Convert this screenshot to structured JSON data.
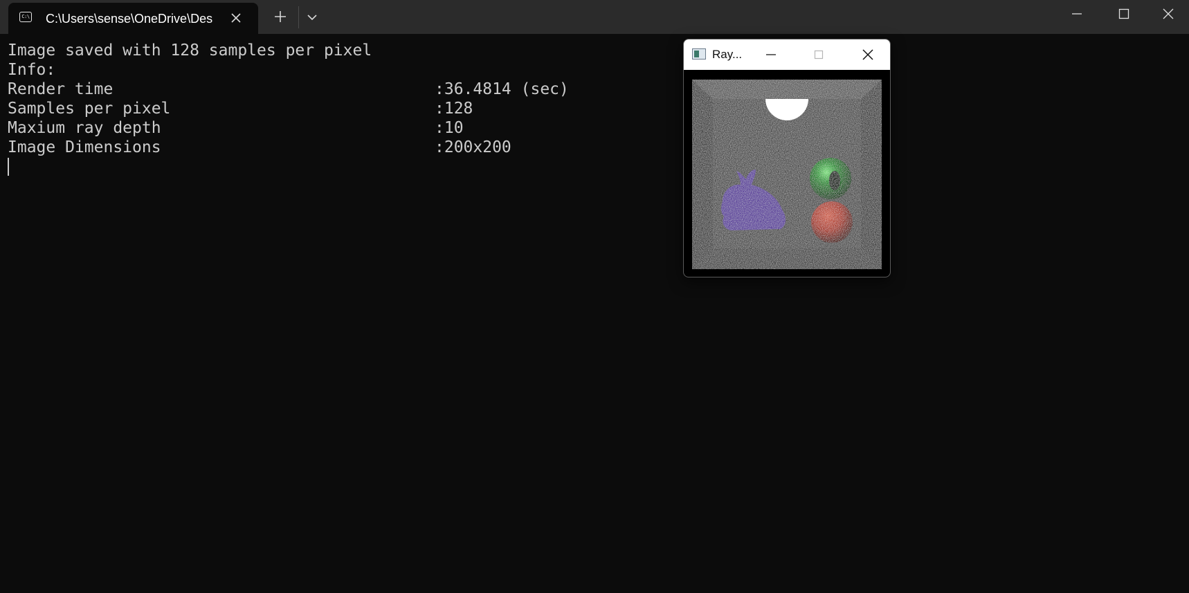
{
  "terminal": {
    "tab_title": "C:\\Users\\sense\\OneDrive\\Des",
    "tab_icon_text": "C:\\",
    "icons": {
      "tab_icon": "terminal-icon",
      "close": "close-icon",
      "new_tab": "plus-icon",
      "dropdown": "chevron-down-icon",
      "minimize": "minimize-icon",
      "maximize": "maximize-icon"
    }
  },
  "console": {
    "line1": "Image saved with 128 samples per pixel",
    "line2": "Info:",
    "rows": [
      {
        "label": "Render time",
        "value": ":36.4814 (sec)"
      },
      {
        "label": "Samples per pixel",
        "value": ":128"
      },
      {
        "label": "Maxium ray depth",
        "value": ":10"
      },
      {
        "label": "Image Dimensions",
        "value": ":200x200"
      }
    ]
  },
  "render_window": {
    "title": "Ray...",
    "image": "cornell box render with light, purple bunny, green sphere and red sphere",
    "colors": {
      "bunny": "#5a3e9a",
      "green_sphere": "#1f8a2a",
      "red_sphere": "#a63525",
      "walls": "#4a4a4a",
      "light": "#ffffff"
    }
  }
}
